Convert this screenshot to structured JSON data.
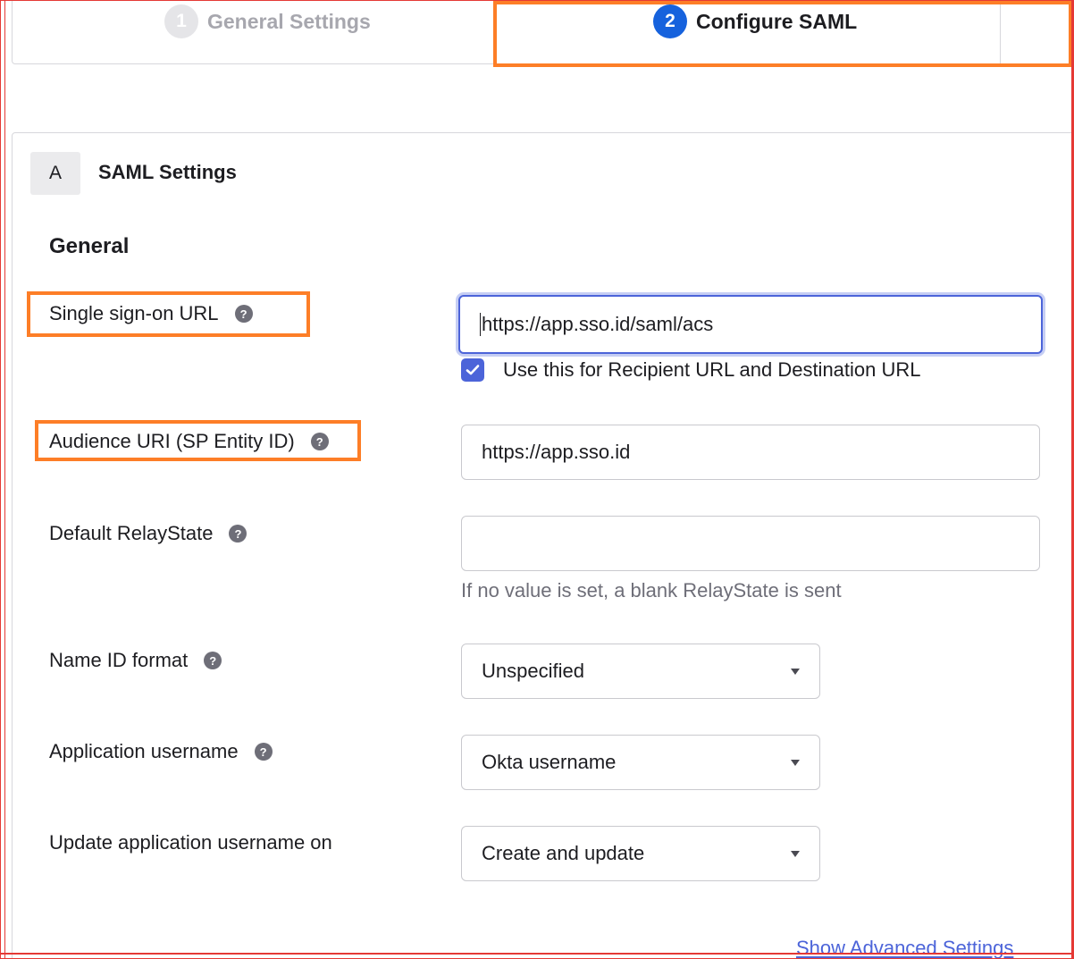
{
  "stepper": {
    "steps": [
      {
        "number": "1",
        "label": "General Settings",
        "state": "inactive"
      },
      {
        "number": "2",
        "label": "Configure SAML",
        "state": "active"
      }
    ]
  },
  "section": {
    "badge": "A",
    "title": "SAML Settings"
  },
  "group": {
    "title": "General"
  },
  "fields": {
    "sso_url": {
      "label": "Single sign-on URL",
      "value": "https://app.sso.id/saml/acs",
      "checkbox_label": "Use this for Recipient URL and Destination URL",
      "checkbox_checked": true
    },
    "audience_uri": {
      "label": "Audience URI (SP Entity ID)",
      "value": "https://app.sso.id"
    },
    "relay_state": {
      "label": "Default RelayState",
      "value": "",
      "hint": "If no value is set, a blank RelayState is sent"
    },
    "name_id_format": {
      "label": "Name ID format",
      "value": "Unspecified"
    },
    "app_username": {
      "label": "Application username",
      "value": "Okta username"
    },
    "update_username_on": {
      "label": "Update application username on",
      "value": "Create and update"
    }
  },
  "links": {
    "advanced": "Show Advanced Settings"
  },
  "icons": {
    "help": "?"
  },
  "colors": {
    "accent": "#4c64d9",
    "step_active": "#1662dd",
    "highlight": "#fd7e27"
  }
}
